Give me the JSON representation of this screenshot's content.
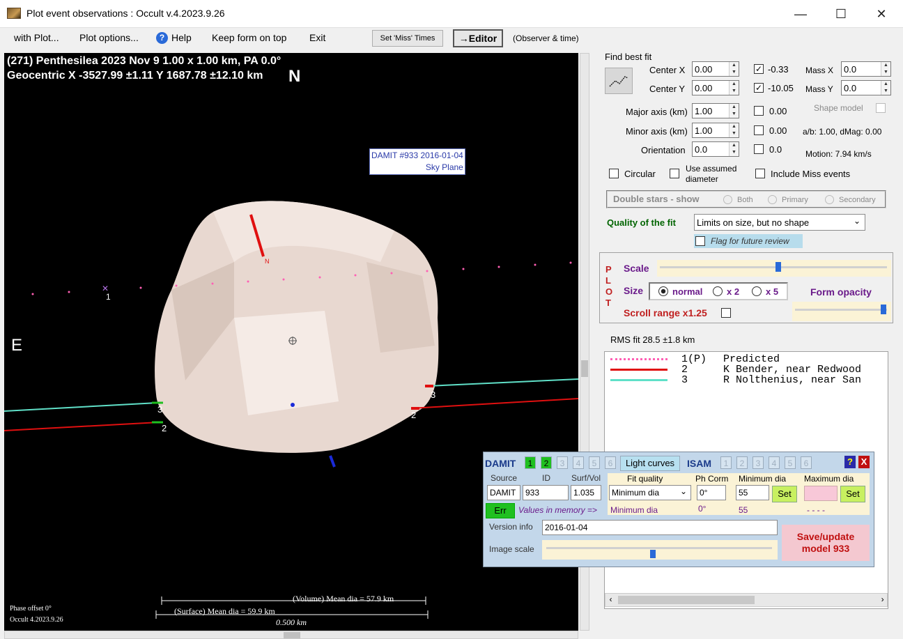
{
  "window": {
    "title": "Plot event observations : Occult v.4.2023.9.26",
    "minimize": "—",
    "maximize": "☐",
    "close": "✕"
  },
  "menu": {
    "with_plot": "with Plot...",
    "plot_options": "Plot options...",
    "help": "Help",
    "keep_on_top": "Keep form on top",
    "exit": "Exit",
    "set_miss": "Set 'Miss' Times",
    "editor": "→Editor",
    "observer_time": "(Observer & time)"
  },
  "plot": {
    "header1": "(271) Penthesilea  2023 Nov 9   1.00 x 1.00 km, PA 0.0°",
    "header2": "Geocentric  X  -3527.99 ±1.11   Y  1687.78 ±12.10 km",
    "north": "N",
    "east": "E",
    "damit_label1": "DAMIT #933 2016-01-04",
    "damit_label2": "Sky Plane",
    "n_marker": "N",
    "chord_labels": {
      "c1": "1",
      "c2a": "2",
      "c3a": "3",
      "c2b": "2",
      "c3b": "3"
    },
    "volume_mean": "(Volume) Mean dia = 57.9 km",
    "surface_mean": "(Surface) Mean dia = 59.9 km",
    "scale_km": "0.500 km",
    "phase_offset": "Phase offset 0°",
    "version": "Occult 4.2023.9.26"
  },
  "fit": {
    "find_best_fit": "Find best fit",
    "center_x_label": "Center X",
    "center_x": "0.00",
    "center_x_chk": "✓",
    "center_x_res": "-0.33",
    "center_y_label": "Center Y",
    "center_y": "0.00",
    "center_y_chk": "✓",
    "center_y_res": "-10.05",
    "mass_x_label": "Mass X",
    "mass_x": "0.0",
    "mass_y_label": "Mass Y",
    "mass_y": "0.0",
    "major_label": "Major axis (km)",
    "major": "1.00",
    "major_res": "0.00",
    "minor_label": "Minor axis (km)",
    "minor": "1.00",
    "minor_res": "0.00",
    "orient_label": "Orientation",
    "orient": "0.0",
    "orient_res": "0.0",
    "shape_model": "Shape model",
    "ab_dmag": "a/b: 1.00, dMag: 0.00",
    "motion": "Motion: 7.94 km/s",
    "circular": "Circular",
    "use_assumed": "Use assumed diameter",
    "include_miss": "Include Miss events",
    "double_stars": "Double stars - show",
    "both": "Both",
    "primary": "Primary",
    "secondary": "Secondary",
    "quality_label": "Quality of the fit",
    "quality_value": "Limits on size, but no shape",
    "flag_review": "Flag for future review"
  },
  "plotbox": {
    "letters": [
      "P",
      "L",
      "O",
      "T"
    ],
    "scale": "Scale",
    "scale_level": 0.52,
    "size": "Size",
    "normal": "normal",
    "x2": "x 2",
    "x5": "x 5",
    "form_opacity": "Form opacity",
    "opacity_level": 0.98,
    "scroll_range": "Scroll range x1.25"
  },
  "rms": "RMS fit 28.5 ±1.8 km",
  "legend": [
    {
      "num": "1(P)",
      "name": "Predicted",
      "color": "#ff5fb4"
    },
    {
      "num": "2",
      "name": "K Bender, near Redwood",
      "color": "#e01010"
    },
    {
      "num": "3",
      "name": "R Nolthenius, near San",
      "color": "#60e0c8"
    }
  ],
  "damit": {
    "title": "DAMIT",
    "nums": [
      "1",
      "2",
      "3",
      "4",
      "5",
      "6"
    ],
    "light_curves": "Light curves",
    "isam": "ISAM",
    "isam_nums": [
      "1",
      "2",
      "3",
      "4",
      "5",
      "6"
    ],
    "help": "?",
    "close": "X",
    "source_h": "Source",
    "id_h": "ID",
    "surfvol_h": "Surf/Vol",
    "source": "DAMIT",
    "id": "933",
    "surfvol": "1.035",
    "fit_quality_h": "Fit quality",
    "phcorr_h": "Ph Corm",
    "mindia_h": "Minimum dia",
    "maxdia_h": "Maximum dia",
    "fit_quality": "Minimum dia",
    "phcorr": "0°",
    "mindia": "55",
    "set": "Set",
    "err": "Err",
    "values_mem": "Values in memory =>",
    "mem_fit": "Minimum dia",
    "mem_ph": "0°",
    "mem_min": "55",
    "mem_max": "- - - -",
    "version_info_label": "Version info",
    "version_info": "2016-01-04",
    "image_scale": "Image scale",
    "image_scale_level": 0.47,
    "save": "Save/update model 933"
  }
}
